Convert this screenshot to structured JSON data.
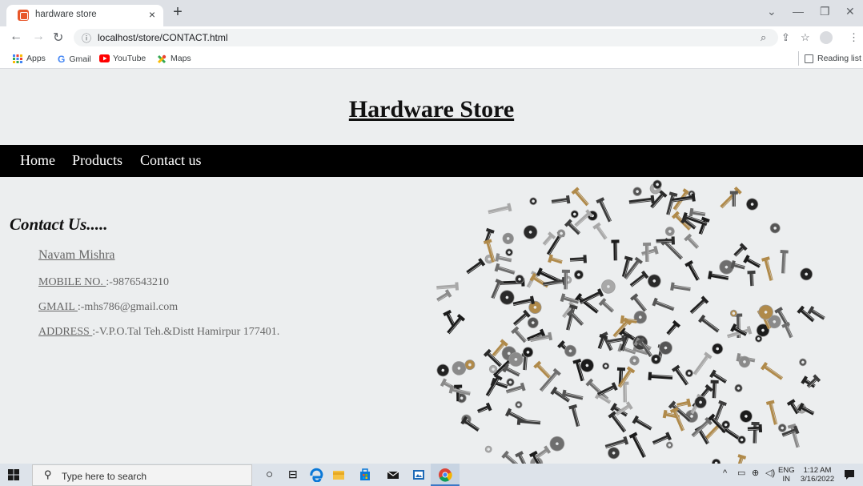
{
  "browser": {
    "tab_title": "hardware store",
    "tab_close": "×",
    "new_tab": "+",
    "url": "localhost/store/CONTACT.html",
    "bookmarks": [
      {
        "label": "Apps",
        "icon": "apps-grid-icon"
      },
      {
        "label": "Gmail",
        "icon": "gmail-icon"
      },
      {
        "label": "YouTube",
        "icon": "youtube-icon"
      },
      {
        "label": "Maps",
        "icon": "maps-icon"
      }
    ],
    "reading_list": "Reading list"
  },
  "page": {
    "title": "Hardware Store",
    "nav": [
      "Home",
      "Products",
      "Contact us"
    ],
    "contact_heading": "Contact Us.....",
    "name": "Navam Mishra",
    "mobile_label": "MOBILE NO. ",
    "mobile_value": ":-9876543210",
    "gmail_label": "GMAIL ",
    "gmail_value": ":-mhs786@gmail.com",
    "address_label": "ADDRESS ",
    "address_value": ":-V.P.O.Tal Teh.&Distt Hamirpur 177401."
  },
  "taskbar": {
    "search_placeholder": "Type here to search",
    "lang_top": "ENG",
    "lang_bottom": "IN",
    "time": "1:12 AM",
    "date": "3/16/2022"
  },
  "colors": {
    "page_bg": "#eceeef",
    "nav_bg": "#000000",
    "tab_bar": "#dee1e6",
    "taskbar": "#dde3ea"
  }
}
